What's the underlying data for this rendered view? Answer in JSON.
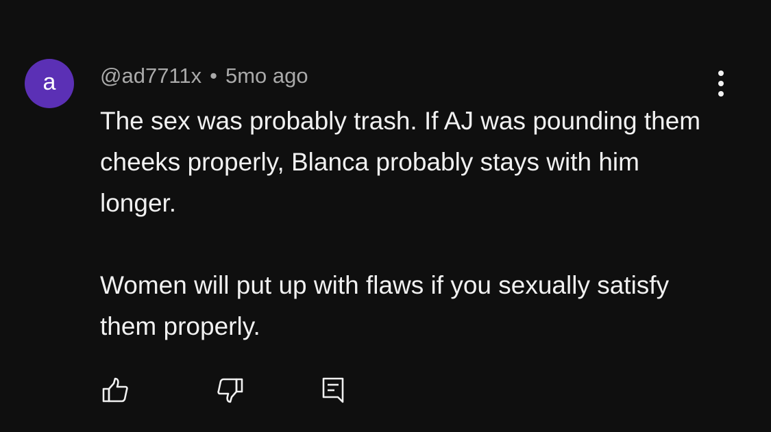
{
  "comment": {
    "avatar_letter": "a",
    "author": "@ad7711x",
    "separator": "•",
    "time": "5mo ago",
    "paragraphs": [
      "The sex was probably trash. If AJ was pounding them cheeks properly, Blanca probably stays with him longer.",
      "Women will put up with flaws if you sexually satisfy them properly."
    ]
  },
  "colors": {
    "background": "#0f0f0f",
    "avatar": "#5b30b5",
    "text_primary": "#f1f1f1",
    "text_secondary": "#aaaaaa"
  },
  "icons": {
    "more": "more-vertical-icon",
    "like": "thumbs-up-icon",
    "dislike": "thumbs-down-icon",
    "reply": "reply-comment-icon"
  }
}
